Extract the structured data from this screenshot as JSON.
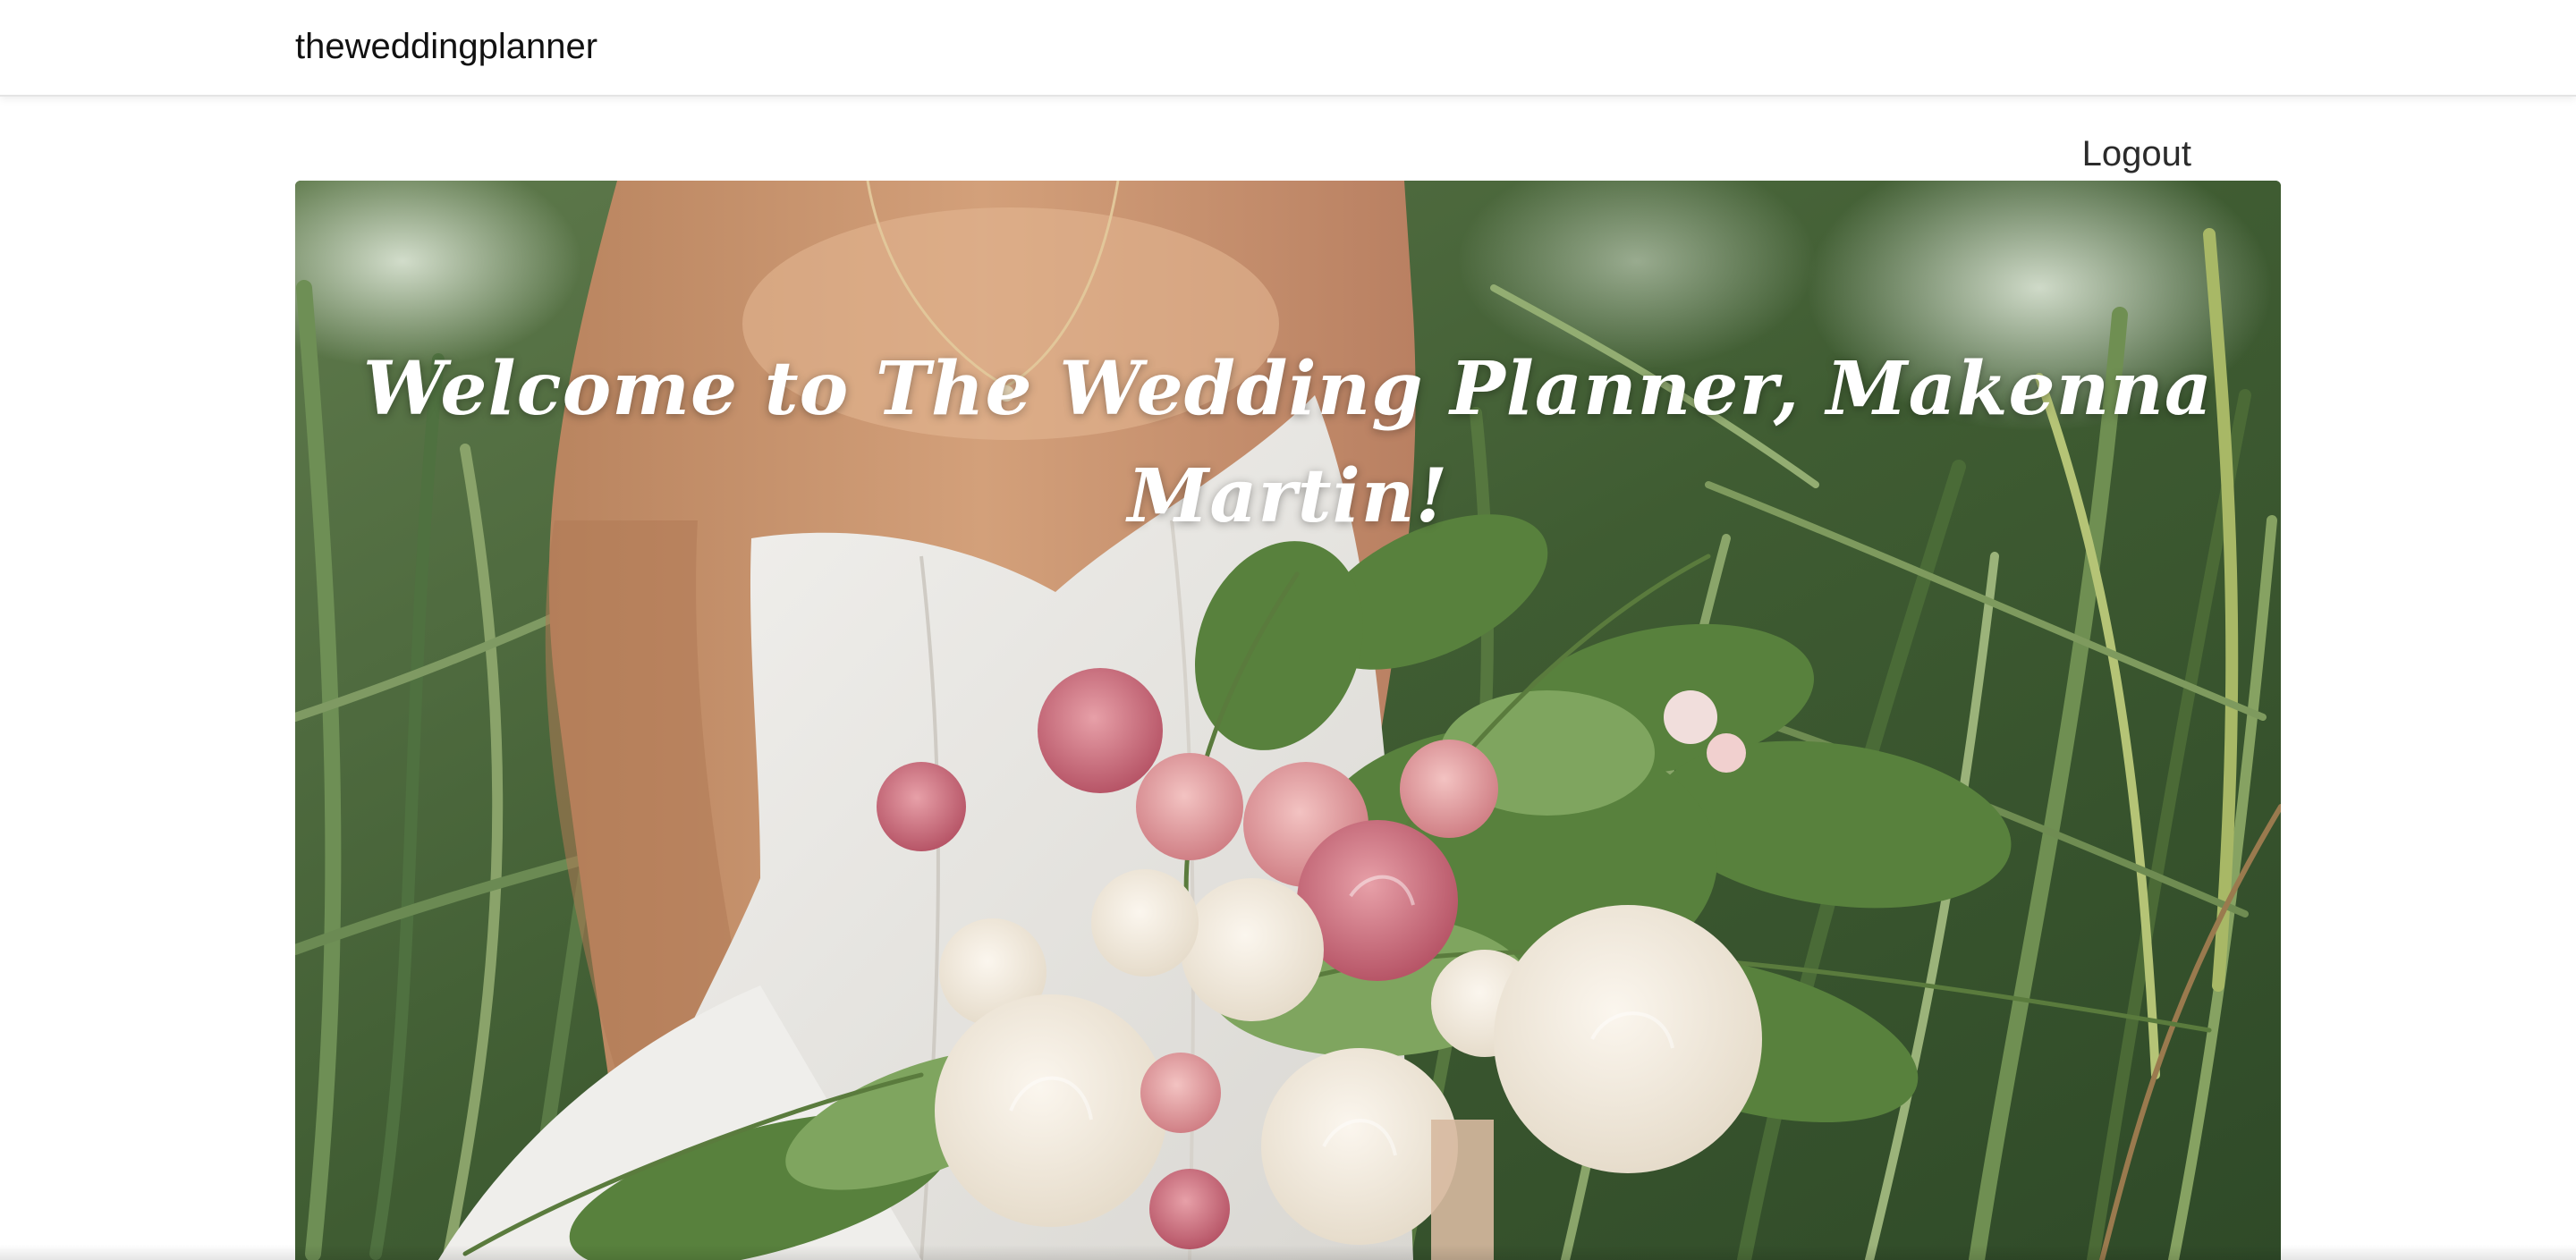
{
  "navbar": {
    "brand": "theweddingplanner",
    "logout_label": "Logout"
  },
  "hero": {
    "title": "Welcome to The Wedding Planner, Makenna Martin!",
    "image_subject": "bride-with-bouquet-photo"
  },
  "colors": {
    "navbar_bg": "#ffffff",
    "text_dark": "#111111",
    "title_text": "#ffffff",
    "foliage_green": "#4d6a3c",
    "dress_white": "#eceae6",
    "rose_pink": "#d98a92",
    "cream_rose": "#f2ebdf"
  }
}
